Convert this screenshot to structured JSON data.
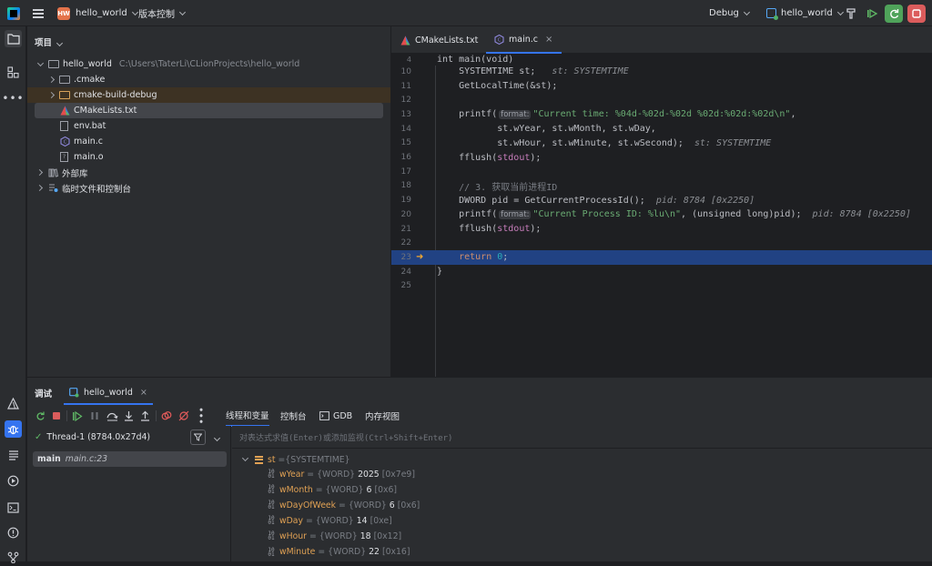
{
  "titlebar": {
    "project_badge": "HW",
    "project_name": "hello_world",
    "vcs_menu": "版本控制",
    "run_config_debug": "Debug",
    "run_target": "hello_world"
  },
  "project_panel": {
    "title": "项目",
    "root_name": "hello_world",
    "root_path": "C:\\Users\\TaterLi\\CLionProjects\\hello_world",
    "items": [
      {
        "name": ".cmake",
        "kind": "folder"
      },
      {
        "name": "cmake-build-debug",
        "kind": "folder"
      },
      {
        "name": "CMakeLists.txt",
        "kind": "cmake"
      },
      {
        "name": "env.bat",
        "kind": "file"
      },
      {
        "name": "main.c",
        "kind": "c"
      },
      {
        "name": "main.o",
        "kind": "obj"
      }
    ],
    "external_libs": "外部库",
    "scratches": "临时文件和控制台"
  },
  "editor": {
    "tabs": [
      {
        "label": "CMakeLists.txt",
        "active": false
      },
      {
        "label": "main.c",
        "active": true
      }
    ],
    "function_header": "int main(void)",
    "lines": [
      {
        "n": "10",
        "segs": [
          {
            "t": "    SYSTEMTIME st;",
            "c": ""
          },
          {
            "t": "   st: SYSTEMTIME",
            "c": "hint"
          }
        ]
      },
      {
        "n": "11",
        "segs": [
          {
            "t": "    GetLocalTime(&st);",
            "c": ""
          }
        ]
      },
      {
        "n": "12",
        "segs": []
      },
      {
        "n": "13",
        "segs": [
          {
            "t": "    printf(",
            "c": ""
          },
          {
            "t": "format:",
            "c": "pill"
          },
          {
            "t": "\"Current time: %04d-%02d-%02d %02d:%02d:%02d\\n\"",
            "c": "str"
          },
          {
            "t": ",",
            "c": ""
          }
        ]
      },
      {
        "n": "14",
        "segs": [
          {
            "t": "           st.wYear, st.wMonth, st.wDay,",
            "c": ""
          }
        ]
      },
      {
        "n": "15",
        "segs": [
          {
            "t": "           st.wHour, st.wMinute, st.wSecond);",
            "c": ""
          },
          {
            "t": "  st: SYSTEMTIME",
            "c": "hint"
          }
        ]
      },
      {
        "n": "16",
        "segs": [
          {
            "t": "    fflush(",
            "c": ""
          },
          {
            "t": "stdout",
            "c": "purple"
          },
          {
            "t": ");",
            "c": ""
          }
        ]
      },
      {
        "n": "17",
        "segs": []
      },
      {
        "n": "18",
        "segs": [
          {
            "t": "    // 3. 获取当前进程ID",
            "c": "cmt"
          }
        ]
      },
      {
        "n": "19",
        "segs": [
          {
            "t": "    DWORD pid = GetCurrentProcessId();",
            "c": ""
          },
          {
            "t": "  pid: 8784 [0x2250]",
            "c": "hint"
          }
        ]
      },
      {
        "n": "20",
        "segs": [
          {
            "t": "    printf(",
            "c": ""
          },
          {
            "t": "format:",
            "c": "pill"
          },
          {
            "t": "\"Current Process ID: %lu\\n\"",
            "c": "str"
          },
          {
            "t": ", (unsigned long)pid);",
            "c": ""
          },
          {
            "t": "  pid: 8784 [0x2250]",
            "c": "hint"
          }
        ]
      },
      {
        "n": "21",
        "segs": [
          {
            "t": "    fflush(",
            "c": ""
          },
          {
            "t": "stdout",
            "c": "purple"
          },
          {
            "t": ");",
            "c": ""
          }
        ]
      },
      {
        "n": "22",
        "segs": []
      },
      {
        "n": "23",
        "segs": [
          {
            "t": "    ",
            "c": ""
          },
          {
            "t": "return",
            "c": "kw"
          },
          {
            "t": " ",
            "c": ""
          },
          {
            "t": "0",
            "c": "num"
          },
          {
            "t": ";",
            "c": ""
          }
        ],
        "current": true
      },
      {
        "n": "24",
        "segs": [
          {
            "t": "}",
            "c": ""
          }
        ]
      },
      {
        "n": "25",
        "segs": []
      }
    ]
  },
  "debug_panel": {
    "title": "调试",
    "session_tab": "hello_world",
    "subtabs": [
      "线程和变量",
      "控制台",
      "GDB",
      "内存视图"
    ],
    "thread": "Thread-1 (8784.0x27d4)",
    "frame_func": "main",
    "frame_loc": "main.c:23",
    "eval_placeholder": "对表达式求值(Enter)或添加监视(Ctrl+Shift+Enter)",
    "root_var": {
      "name": "st",
      "type": "{SYSTEMTIME}"
    },
    "fields": [
      {
        "name": "wYear",
        "type": "{WORD}",
        "value": "2025",
        "hex": "[0x7e9]"
      },
      {
        "name": "wMonth",
        "type": "{WORD}",
        "value": "6",
        "hex": "[0x6]"
      },
      {
        "name": "wDayOfWeek",
        "type": "{WORD}",
        "value": "6",
        "hex": "[0x6]"
      },
      {
        "name": "wDay",
        "type": "{WORD}",
        "value": "14",
        "hex": "[0xe]"
      },
      {
        "name": "wHour",
        "type": "{WORD}",
        "value": "18",
        "hex": "[0x12]"
      },
      {
        "name": "wMinute",
        "type": "{WORD}",
        "value": "22",
        "hex": "[0x16]"
      }
    ]
  }
}
